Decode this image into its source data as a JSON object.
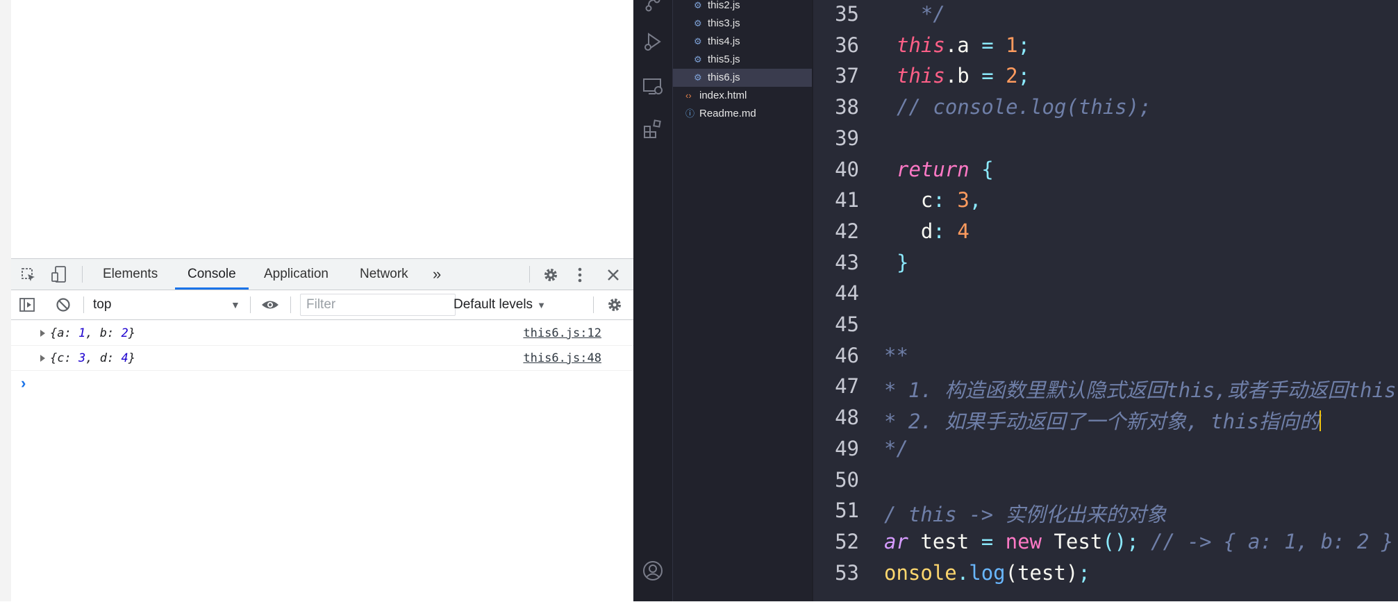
{
  "devtools": {
    "tabs": [
      "Elements",
      "Console",
      "Application",
      "Network"
    ],
    "more_tabs_glyph": "»",
    "active_tab": "Console",
    "context": "top",
    "filter_placeholder": "Filter",
    "levels": "Default levels",
    "logs": [
      {
        "k1": "a",
        "v1": "1",
        "k2": "b",
        "v2": "2",
        "source": "this6.js:12"
      },
      {
        "k1": "c",
        "v1": "3",
        "k2": "d",
        "v2": "4",
        "source": "this6.js:48"
      }
    ],
    "prompt": "›",
    "icons": [
      "inspect-element-icon",
      "device-toggle-icon",
      "settings-gear-icon",
      "more-vert-icon",
      "close-icon",
      "sidebar-toggle-icon",
      "clear-console-icon",
      "eye-icon"
    ],
    "accent": "#1a73e8"
  },
  "explorer": {
    "files": [
      {
        "name": "this2.js",
        "icon": "js-file-icon"
      },
      {
        "name": "this3.js",
        "icon": "js-file-icon"
      },
      {
        "name": "this4.js",
        "icon": "js-file-icon"
      },
      {
        "name": "this5.js",
        "icon": "js-file-icon"
      },
      {
        "name": "this6.js",
        "icon": "js-file-icon",
        "active": true
      },
      {
        "name": "index.html",
        "icon": "html-file-icon"
      },
      {
        "name": "Readme.md",
        "icon": "info-file-icon"
      }
    ]
  },
  "editor": {
    "theme": "dark",
    "lines": [
      {
        "n": "35",
        "segments": [
          {
            "t": "  */",
            "c": "com"
          }
        ]
      },
      {
        "n": "36",
        "segments": [
          {
            "t": "this",
            "c": "kw"
          },
          {
            "t": ".a ",
            "c": "tx"
          },
          {
            "t": "=",
            "c": "pn"
          },
          {
            "t": " ",
            "c": "tx"
          },
          {
            "t": "1",
            "c": "num"
          },
          {
            "t": ";",
            "c": "pn"
          }
        ]
      },
      {
        "n": "37",
        "segments": [
          {
            "t": "this",
            "c": "kw"
          },
          {
            "t": ".b ",
            "c": "tx"
          },
          {
            "t": "=",
            "c": "pn"
          },
          {
            "t": " ",
            "c": "tx"
          },
          {
            "t": "2",
            "c": "num"
          },
          {
            "t": ";",
            "c": "pn"
          }
        ]
      },
      {
        "n": "38",
        "segments": [
          {
            "t": "// console.log(this);",
            "c": "com"
          }
        ]
      },
      {
        "n": "39",
        "segments": []
      },
      {
        "n": "40",
        "segments": [
          {
            "t": "return",
            "c": "ret"
          },
          {
            "t": " {",
            "c": "pn"
          }
        ]
      },
      {
        "n": "41",
        "segments": [
          {
            "t": "  c",
            "c": "tx"
          },
          {
            "t": ":",
            "c": "pn"
          },
          {
            "t": " ",
            "c": "tx"
          },
          {
            "t": "3",
            "c": "num"
          },
          {
            "t": ",",
            "c": "pn"
          }
        ]
      },
      {
        "n": "42",
        "segments": [
          {
            "t": "  d",
            "c": "tx"
          },
          {
            "t": ":",
            "c": "pn"
          },
          {
            "t": " ",
            "c": "tx"
          },
          {
            "t": "4",
            "c": "num"
          }
        ]
      },
      {
        "n": "43",
        "segments": [
          {
            "t": "}",
            "c": "pn"
          }
        ]
      },
      {
        "n": "44",
        "segments": []
      },
      {
        "n": "45",
        "segments": []
      },
      {
        "n": "46",
        "segments": [
          {
            "t": "**",
            "c": "com"
          }
        ]
      },
      {
        "n": "47",
        "segments": [
          {
            "t": "* 1. 构造函数里默认隐式返回this,或者手动返回this",
            "c": "com"
          }
        ]
      },
      {
        "n": "48",
        "segments": [
          {
            "t": "* 2. 如果手动返回了一个新对象, this指向的",
            "c": "com"
          }
        ]
      },
      {
        "n": "49",
        "segments": [
          {
            "t": "*/",
            "c": "com"
          }
        ]
      },
      {
        "n": "50",
        "segments": []
      },
      {
        "n": "51",
        "segments": [
          {
            "t": "/ this -> 实例化出来的对象",
            "c": "com"
          }
        ]
      },
      {
        "n": "52",
        "segments": [
          {
            "t": "ar",
            "c": "var"
          },
          {
            "t": " test ",
            "c": "tx"
          },
          {
            "t": "=",
            "c": "pn"
          },
          {
            "t": " ",
            "c": "tx"
          },
          {
            "t": "new",
            "c": "new"
          },
          {
            "t": " Test",
            "c": "tx"
          },
          {
            "t": "();",
            "c": "pn"
          },
          {
            "t": " // -> { a: 1, b: 2 }",
            "c": "com"
          }
        ]
      },
      {
        "n": "53",
        "segments": [
          {
            "t": "onsole",
            "c": "obj"
          },
          {
            "t": ".",
            "c": "pn"
          },
          {
            "t": "log",
            "c": "fn"
          },
          {
            "t": "(test)",
            "c": "tx"
          },
          {
            "t": ";",
            "c": "pn"
          }
        ]
      }
    ],
    "activity_icons": [
      "source-control-icon",
      "run-debug-icon",
      "remote-explorer-icon",
      "extensions-icon",
      "account-icon"
    ]
  }
}
